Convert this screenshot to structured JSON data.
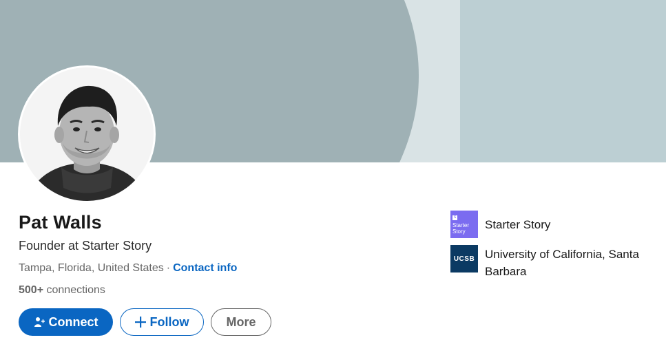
{
  "profile": {
    "name": "Pat Walls",
    "headline": "Founder at Starter Story",
    "location": "Tampa, Florida, United States",
    "separator": "·",
    "contact_info": "Contact info",
    "connections_count": "500+",
    "connections_label": "connections"
  },
  "actions": {
    "connect": "Connect",
    "follow": "Follow",
    "more": "More"
  },
  "organizations": [
    {
      "name": "Starter Story",
      "logo_line1": "Starter",
      "logo_line2": "Story",
      "logo_mark": "S"
    },
    {
      "name": "University of California, Santa Barbara",
      "logo_text": "UCSB"
    }
  ],
  "colors": {
    "accent": "#0a66c2",
    "banner_dark": "#9fb1b5",
    "banner_light": "#d9e3e5",
    "banner_right": "#bccfd3",
    "starter_logo": "#7b6cf0",
    "ucsb_logo": "#0b3a63"
  },
  "icons": {
    "connect": "add-person-icon",
    "follow": "plus-icon"
  }
}
